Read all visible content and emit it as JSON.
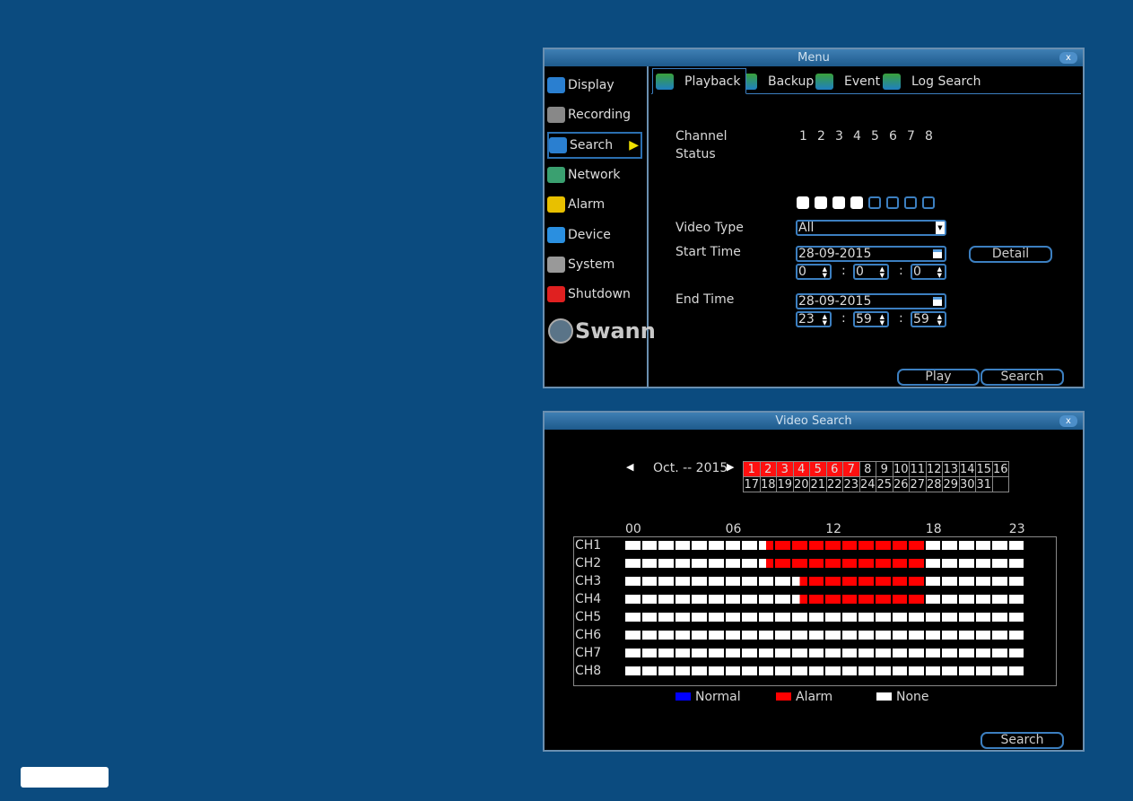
{
  "menu_window": {
    "title": "Menu",
    "close": "x",
    "sidebar": [
      {
        "label": "Display",
        "icon": "display-icon",
        "color": "#2a7fd0"
      },
      {
        "label": "Recording",
        "icon": "recording-icon",
        "color": "#888888"
      },
      {
        "label": "Search",
        "icon": "search-icon",
        "color": "#2a7fd0",
        "selected": true
      },
      {
        "label": "Network",
        "icon": "network-icon",
        "color": "#3aa070"
      },
      {
        "label": "Alarm",
        "icon": "alarm-icon",
        "color": "#e8c000"
      },
      {
        "label": "Device",
        "icon": "device-icon",
        "color": "#2a8fe0"
      },
      {
        "label": "System",
        "icon": "system-icon",
        "color": "#999999"
      },
      {
        "label": "Shutdown",
        "icon": "shutdown-icon",
        "color": "#e02020"
      }
    ],
    "logo": "Swann",
    "tabs": [
      "Playback",
      "Backup",
      "Event",
      "Log Search"
    ],
    "channel_label": "Channel",
    "status_label": "Status",
    "channels": [
      "1",
      "2",
      "3",
      "4",
      "5",
      "6",
      "7",
      "8"
    ],
    "channel_status": [
      true,
      true,
      true,
      true,
      false,
      false,
      false,
      false
    ],
    "video_type_label": "Video Type",
    "video_type": "All",
    "start_time_label": "Start Time",
    "start_date": "28-09-2015",
    "start_h": "0",
    "start_m": "0",
    "start_s": "0",
    "end_time_label": "End Time",
    "end_date": "28-09-2015",
    "end_h": "23",
    "end_m": "59",
    "end_s": "59",
    "sep": ":",
    "detail": "Detail",
    "play": "Play",
    "search": "Search"
  },
  "video_search": {
    "title": "Video Search",
    "close": "x",
    "month": "Oct. -- 2015",
    "prev": "◀",
    "next": "▶",
    "days": [
      "1",
      "2",
      "3",
      "4",
      "5",
      "6",
      "7",
      "8",
      "9",
      "10",
      "11",
      "12",
      "13",
      "14",
      "15",
      "16",
      "17",
      "18",
      "19",
      "20",
      "21",
      "22",
      "23",
      "24",
      "25",
      "26",
      "27",
      "28",
      "29",
      "30",
      "31",
      ""
    ],
    "days_with_records": [
      1,
      2,
      3,
      4,
      5,
      6,
      7
    ],
    "hour_labels": [
      "00",
      "06",
      "12",
      "18",
      "23"
    ],
    "channels": [
      {
        "name": "CH1",
        "alarm": [
          8.5,
          18
        ]
      },
      {
        "name": "CH2",
        "alarm": [
          8.5,
          18
        ]
      },
      {
        "name": "CH3",
        "alarm": [
          10.5,
          18
        ]
      },
      {
        "name": "CH4",
        "alarm": [
          10.5,
          18
        ]
      },
      {
        "name": "CH5",
        "alarm": null
      },
      {
        "name": "CH6",
        "alarm": null
      },
      {
        "name": "CH7",
        "alarm": null
      },
      {
        "name": "CH8",
        "alarm": null
      }
    ],
    "legend": [
      {
        "label": "Normal",
        "color": "#0000ff"
      },
      {
        "label": "Alarm",
        "color": "#ff0000"
      },
      {
        "label": "None",
        "color": "#ffffff"
      }
    ],
    "search": "Search"
  }
}
